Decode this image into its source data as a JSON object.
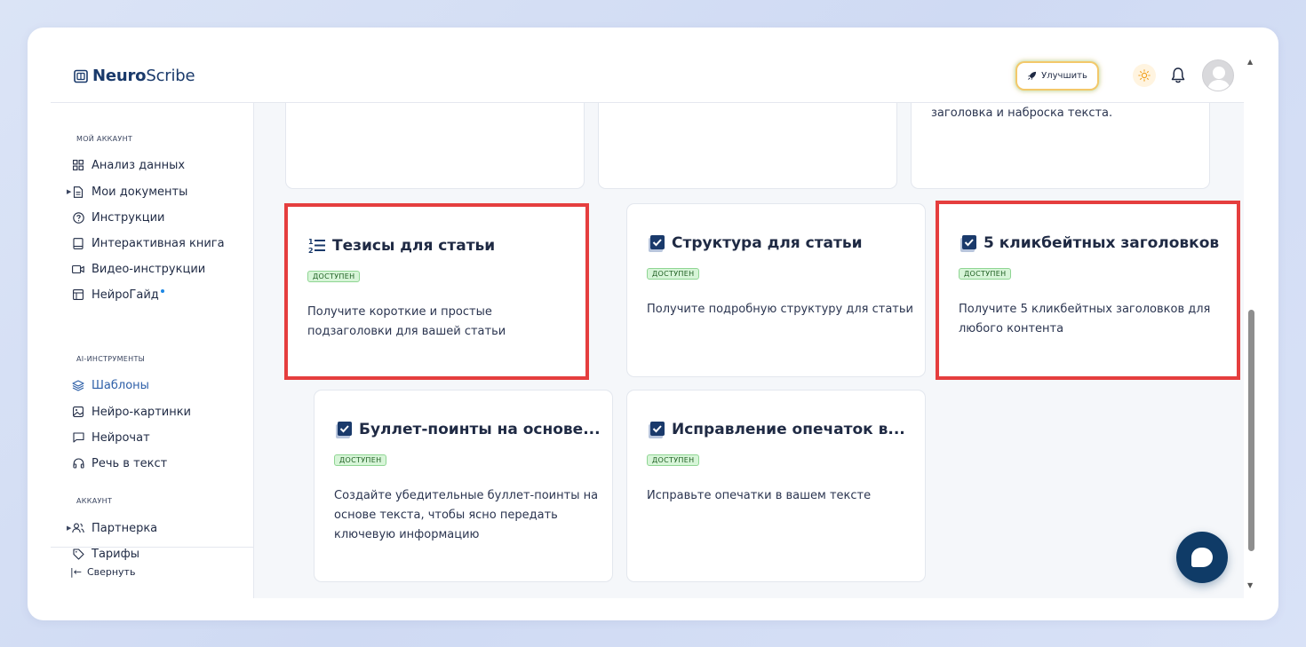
{
  "brand": {
    "name_bold": "Neuro",
    "name_light": "Scribe"
  },
  "header": {
    "upgrade_label": "Улучшить"
  },
  "sidebar": {
    "section_account": "МОЙ АККАУНТ",
    "items_account": [
      {
        "label": "Анализ данных",
        "icon": "grid-icon"
      },
      {
        "label": "Мои документы",
        "icon": "document-icon"
      },
      {
        "label": "Инструкции",
        "icon": "help-circle-icon"
      },
      {
        "label": "Интерактивная книга",
        "icon": "book-icon"
      },
      {
        "label": "Видео-инструкции",
        "icon": "video-icon"
      },
      {
        "label": "НейроГайд",
        "icon": "guide-icon"
      }
    ],
    "section_ai": "AI-ИНСТРУМЕНТЫ",
    "items_ai": [
      {
        "label": "Шаблоны",
        "icon": "layers-icon"
      },
      {
        "label": "Нейро-картинки",
        "icon": "image-icon"
      },
      {
        "label": "Нейрочат",
        "icon": "chat-icon"
      },
      {
        "label": "Речь в текст",
        "icon": "headphones-icon"
      }
    ],
    "section_acc": "АККАУНТ",
    "items_acc": [
      {
        "label": "Партнерка",
        "icon": "users-icon"
      },
      {
        "label": "Тарифы",
        "icon": "tag-icon"
      }
    ],
    "collapse_label": "Свернуть"
  },
  "cards_top": {
    "c3_desc": "заголовка и наброска текста."
  },
  "cards": [
    {
      "title": "Тезисы для статьи",
      "badge": "ДОСТУПЕН",
      "desc": "Получите короткие и простые подзаголовки для вашей статьи",
      "icon": "list-numbered-icon"
    },
    {
      "title": "Структура для статьи",
      "badge": "ДОСТУПЕН",
      "desc": "Получите подробную структуру для статьи",
      "icon": "checkbox-icon"
    },
    {
      "title": "5 кликбейтных заголовков",
      "badge": "ДОСТУПЕН",
      "desc": "Получите 5 кликбейтных заголовков для любого контента",
      "icon": "checkbox-icon"
    },
    {
      "title": "Буллет-поинты на основе...",
      "badge": "ДОСТУПЕН",
      "desc": "Создайте убедительные буллет-поинты на основе текста, чтобы ясно передать ключевую информацию",
      "icon": "checkbox-icon"
    },
    {
      "title": "Исправление опечаток в...",
      "badge": "ДОСТУПЕН",
      "desc": "Исправьте опечатки в вашем тексте",
      "icon": "checkbox-icon"
    }
  ],
  "colors": {
    "accent": "#1a3a6b",
    "highlight": "#e53e3e",
    "badge_bg": "#d7f5d8",
    "chat_button": "#0f3b67"
  }
}
